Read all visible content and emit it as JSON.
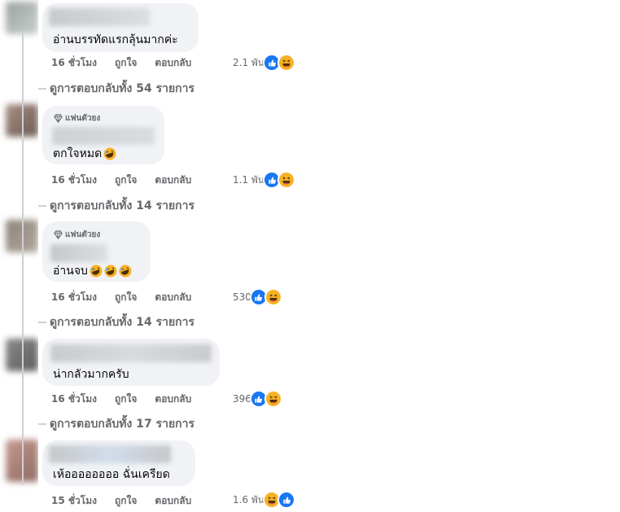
{
  "comments": [
    {
      "badge": "",
      "text": "อ่านบรรทัดแรกลุ้นมากค่ะ",
      "laugh_emojis": 0,
      "time": "16 ชั่วโมง",
      "like": "ถูกใจ",
      "reply": "ตอบกลับ",
      "reaction_count": "2.1 พัน",
      "reaction_icons": [
        "like-reaction-icon",
        "haha-reaction-icon"
      ],
      "view_replies": "ดูการตอบกลับทั้ง 54 รายการ"
    },
    {
      "badge": "แฟนตัวยง",
      "text": "ตกใจหมด",
      "laugh_emojis": 1,
      "time": "16 ชั่วโมง",
      "like": "ถูกใจ",
      "reply": "ตอบกลับ",
      "reaction_count": "1.1 พัน",
      "reaction_icons": [
        "like-reaction-icon",
        "haha-reaction-icon"
      ],
      "view_replies": "ดูการตอบกลับทั้ง 14 รายการ"
    },
    {
      "badge": "แฟนตัวยง",
      "text": "อ่านจบ",
      "laugh_emojis": 3,
      "time": "16 ชั่วโมง",
      "like": "ถูกใจ",
      "reply": "ตอบกลับ",
      "reaction_count": "530",
      "reaction_icons": [
        "like-reaction-icon",
        "haha-reaction-icon"
      ],
      "view_replies": "ดูการตอบกลับทั้ง 14 รายการ"
    },
    {
      "badge": "",
      "text": "น่ากลัวมากครับ",
      "laugh_emojis": 0,
      "time": "16 ชั่วโมง",
      "like": "ถูกใจ",
      "reply": "ตอบกลับ",
      "reaction_count": "396",
      "reaction_icons": [
        "like-reaction-icon",
        "haha-reaction-icon"
      ],
      "view_replies": "ดูการตอบกลับทั้ง 17 รายการ"
    },
    {
      "badge": "",
      "text": "เห้ออออออออ ฉั่นเครียด",
      "laugh_emojis": 0,
      "time": "15 ชั่วโมง",
      "like": "ถูกใจ",
      "reply": "ตอบกลับ",
      "reaction_count": "1.6 พัน",
      "reaction_icons": [
        "haha-reaction-icon",
        "like-reaction-icon"
      ],
      "view_replies": ""
    }
  ],
  "colors": {
    "bubble": "#f0f2f5",
    "secondary_text": "#65676b",
    "like_blue": "#1877f2",
    "haha_yellow": "#f7b125"
  }
}
